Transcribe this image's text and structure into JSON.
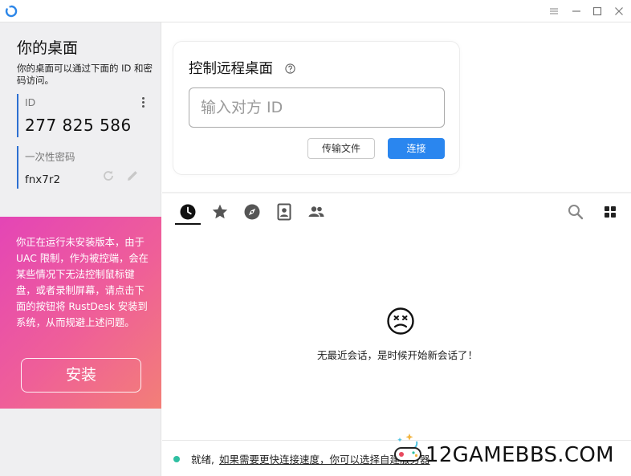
{
  "sidebar": {
    "title": "你的桌面",
    "description": "你的桌面可以通过下面的 ID 和密码访问。",
    "id_label": "ID",
    "id_value": "277 825 586",
    "password_label": "一次性密码",
    "password_value": "fnx7r2",
    "promo_text": "你正在运行未安装版本，由于 UAC 限制，作为被控端，会在某些情况下无法控制鼠标键盘，或者录制屏幕，请点击下面的按钮将 RustDesk 安装到系统，从而规避上述问题。",
    "install_label": "安装"
  },
  "connect": {
    "title": "控制远程桌面",
    "placeholder": "输入对方 ID",
    "transfer_label": "传输文件",
    "connect_label": "连接"
  },
  "sessions": {
    "empty_text": "无最近会话，是时候开始新会话了！"
  },
  "status": {
    "ready": "就绪,",
    "hint": "如果需要更快连接速度，你可以选择自建服务器"
  },
  "watermark": {
    "text": "12GAMEBBS.COM"
  },
  "colors": {
    "accent": "#2a86ef",
    "id_bar": "#2c6fd1",
    "promo_start": "#e445b6",
    "promo_end": "#f37f77",
    "status_ok": "#2fbfa2"
  }
}
